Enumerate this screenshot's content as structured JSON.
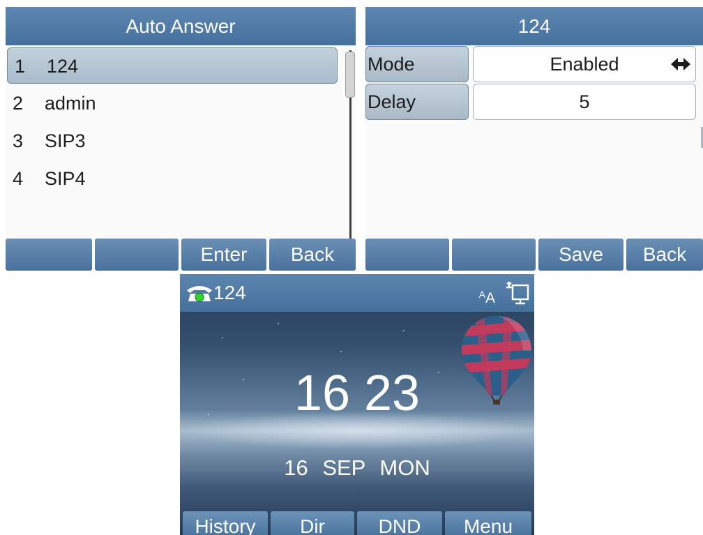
{
  "auto_answer_list": {
    "title": "Auto  Answer",
    "items": [
      {
        "index": "1",
        "label": "124",
        "selected": true
      },
      {
        "index": "2",
        "label": "admin"
      },
      {
        "index": "3",
        "label": "SIP3"
      },
      {
        "index": "4",
        "label": "SIP4"
      }
    ],
    "softkeys": [
      "",
      "",
      "Enter",
      "Back"
    ]
  },
  "account_settings": {
    "title": "124",
    "mode_label": "Mode",
    "mode_value": "Enabled",
    "delay_label": "Delay",
    "delay_value": "5",
    "softkeys": [
      "",
      "",
      "Save",
      "Back"
    ]
  },
  "idle_screen": {
    "account": "124",
    "time": "16 23",
    "date": "16  SEP  MON",
    "font_indicator": "AA",
    "softkeys": [
      "History",
      "Dir",
      "DND",
      "Menu"
    ]
  },
  "colors": {
    "title_bar": "#4f7aa6",
    "selected_row": "#b6c7d4",
    "softkey": "#5a82ab",
    "line_registered": "#2fd12f"
  },
  "icons": [
    "arrows-left-right-icon",
    "phone-icon",
    "font-size-icon",
    "network-icon",
    "hot-air-balloon-image"
  ]
}
